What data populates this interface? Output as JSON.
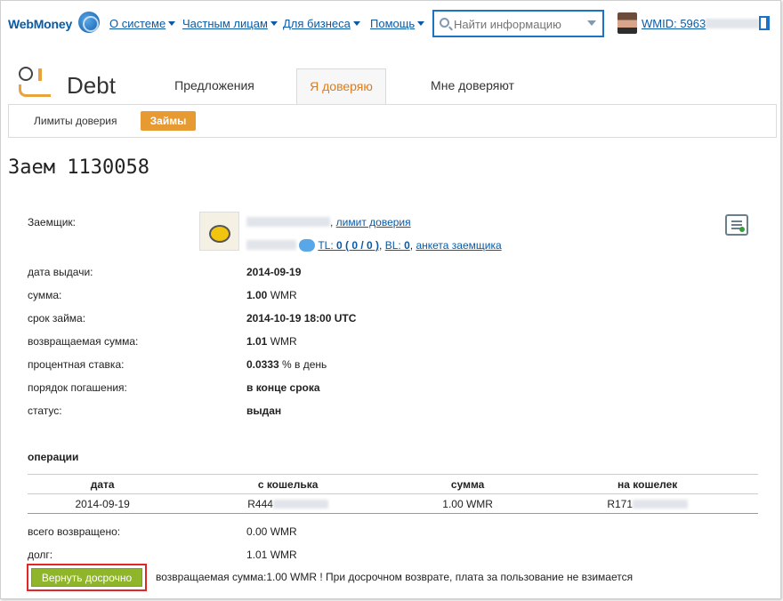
{
  "header": {
    "logo": "WebMoney",
    "nav": [
      {
        "label": "О системе"
      },
      {
        "label": "Частным лицам"
      },
      {
        "label": "Для бизнеса"
      },
      {
        "label": "Помощь"
      }
    ],
    "search_placeholder": "Найти информацию",
    "wmid_label": "WMID: 5963"
  },
  "app": {
    "title": "Debt",
    "tabs": [
      {
        "label": "Предложения"
      },
      {
        "label": "Я доверяю",
        "active": true
      },
      {
        "label": "Мне доверяют"
      }
    ],
    "subnav": {
      "limits": "Лимиты доверия",
      "loans": "Займы"
    }
  },
  "loan": {
    "title": "Заем 1130058",
    "borrower_label": "Заемщик:",
    "borrower_links": {
      "trust_limit": "лимит доверия",
      "tl_prefix": "TL: ",
      "tl_value": "0 ( 0 / 0 )",
      "bl_prefix": "BL: ",
      "bl_value": "0",
      "profile": "анкета заемщика"
    },
    "details": [
      {
        "label": "дата выдачи:",
        "value": "2014-09-19",
        "unit": ""
      },
      {
        "label": "сумма:",
        "value": "1.00",
        "unit": " WMR"
      },
      {
        "label": "срок займа:",
        "value": "2014-10-19 18:00 UTC",
        "unit": ""
      },
      {
        "label": "возвращаемая сумма:",
        "value": "1.01",
        "unit": " WMR"
      },
      {
        "label": "процентная ставка:",
        "value": "0.0333",
        "unit": " % в день"
      },
      {
        "label": "порядок погашения:",
        "value": "в конце срока",
        "unit": ""
      },
      {
        "label": "статус:",
        "value": "выдан",
        "unit": ""
      }
    ]
  },
  "operations": {
    "title": "операции",
    "columns": [
      "дата",
      "с кошелька",
      "сумма",
      "на кошелек"
    ],
    "rows": [
      {
        "date": "2014-09-19",
        "from": "R444",
        "amount": "1.00 WMR",
        "to": "R171"
      }
    ],
    "total_returned_label": "всего возвращено:",
    "total_returned_value": "0.00 WMR",
    "debt_label": "долг:",
    "debt_value": "1.01 WMR"
  },
  "early_return": {
    "button": "Вернуть досрочно",
    "note": "возвращаемая сумма:1.00 WMR ! При досрочном возврате, плата за пользование не взимается"
  },
  "colors": {
    "accent_blue": "#0a5aa6",
    "accent_orange": "#e89a32",
    "button_green": "#8fb62b",
    "highlight_red": "#e02727"
  }
}
